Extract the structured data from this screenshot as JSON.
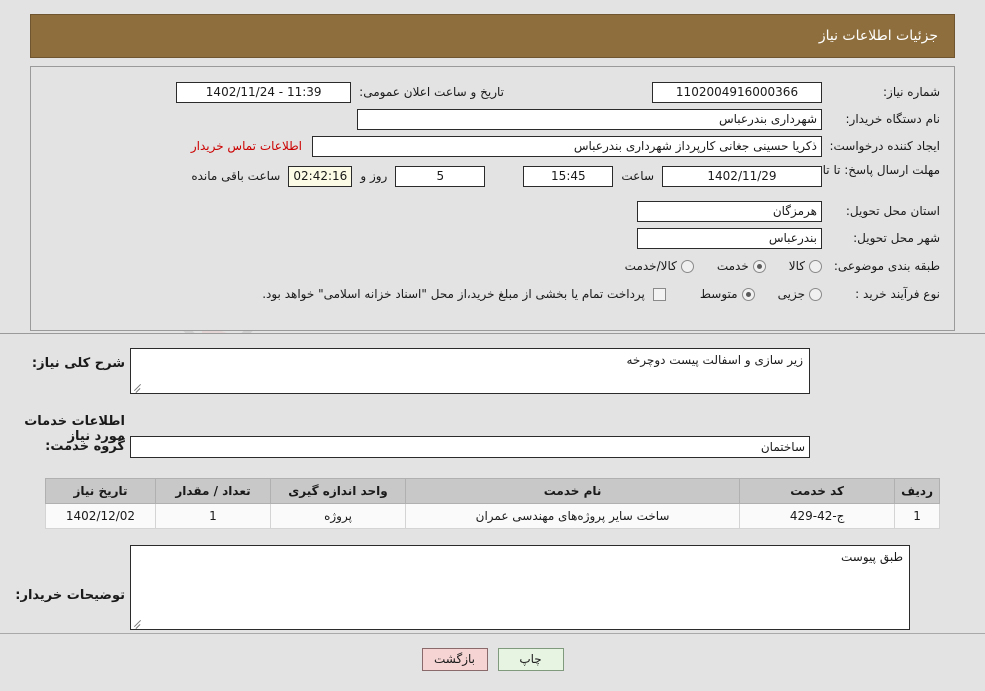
{
  "header": {
    "title": "جزئیات اطلاعات نیاز"
  },
  "watermark": {
    "text": "AriaTender.net"
  },
  "top_form": {
    "need_number_label": "شماره نیاز:",
    "need_number_value": "1102004916000366",
    "announce_datetime_label": "تاریخ و ساعت اعلان عمومی:",
    "announce_datetime_value": "11:39 - 1402/11/24",
    "buyer_org_label": "نام دستگاه خریدار:",
    "buyer_org_value": "شهرداری بندرعباس",
    "requester_label": "ایجاد کننده درخواست:",
    "requester_value": "ذکریا حسینی جغانی کارپرداز شهرداری بندرعباس",
    "buyer_contact_link": "اطلاعات تماس خریدار",
    "deadline_label": "مهلت ارسال پاسخ: تا تاریخ:",
    "deadline_date_value": "1402/11/29",
    "deadline_time_label": "ساعت",
    "deadline_time_value": "15:45",
    "remaining_days_value": "5",
    "remaining_days_label": "روز و",
    "remaining_clock_value": "02:42:16",
    "remaining_clock_label": "ساعت باقی مانده",
    "province_label": "استان محل تحویل:",
    "province_value": "هرمزگان",
    "city_label": "شهر محل تحویل:",
    "city_value": "بندرعباس",
    "category_label": "طبقه بندی موضوعی:",
    "category_options": [
      {
        "label": "کالا",
        "selected": false
      },
      {
        "label": "خدمت",
        "selected": true
      },
      {
        "label": "کالا/خدمت",
        "selected": false
      }
    ],
    "process_type_label": "نوع فرآیند خرید :",
    "process_type_options": [
      {
        "label": "جزیی",
        "selected": false
      },
      {
        "label": "متوسط",
        "selected": true
      }
    ],
    "treasury_checkbox_checked": false,
    "treasury_note": "پرداخت تمام یا بخشی از مبلغ خرید،از محل \"اسناد خزانه اسلامی\" خواهد بود."
  },
  "mid": {
    "general_desc_label": "شرح کلی نیاز:",
    "general_desc_value": "زیر سازی و اسفالت پیست دوچرخه",
    "services_section_title": "اطلاعات خدمات مورد نیاز",
    "service_group_label": "گروه خدمت:",
    "service_group_value": "ساختمان",
    "buyer_notes_label": "توضیحات خریدار:",
    "buyer_notes_value": "طبق پیوست"
  },
  "table": {
    "columns": [
      "ردیف",
      "کد خدمت",
      "نام خدمت",
      "واحد اندازه گیری",
      "تعداد / مقدار",
      "تاریخ نیاز"
    ],
    "rows": [
      {
        "index": "1",
        "code": "ج-42-429",
        "name": "ساخت سایر پروژه‌های مهندسی عمران",
        "unit": "پروژه",
        "quantity": "1",
        "need_date": "1402/12/02"
      }
    ]
  },
  "footer": {
    "print_label": "چاپ",
    "return_label": "بازگشت"
  },
  "colors": {
    "header_brown": "#8d6e3c",
    "page_background": "#e3e3e3",
    "link_red": "#cc0000",
    "countdown_yellow": "#fbfbe6",
    "table_header_gray": "#c8c8c8",
    "print_button_green": "#e6f4e1",
    "return_button_pink": "#f7d4d4"
  }
}
